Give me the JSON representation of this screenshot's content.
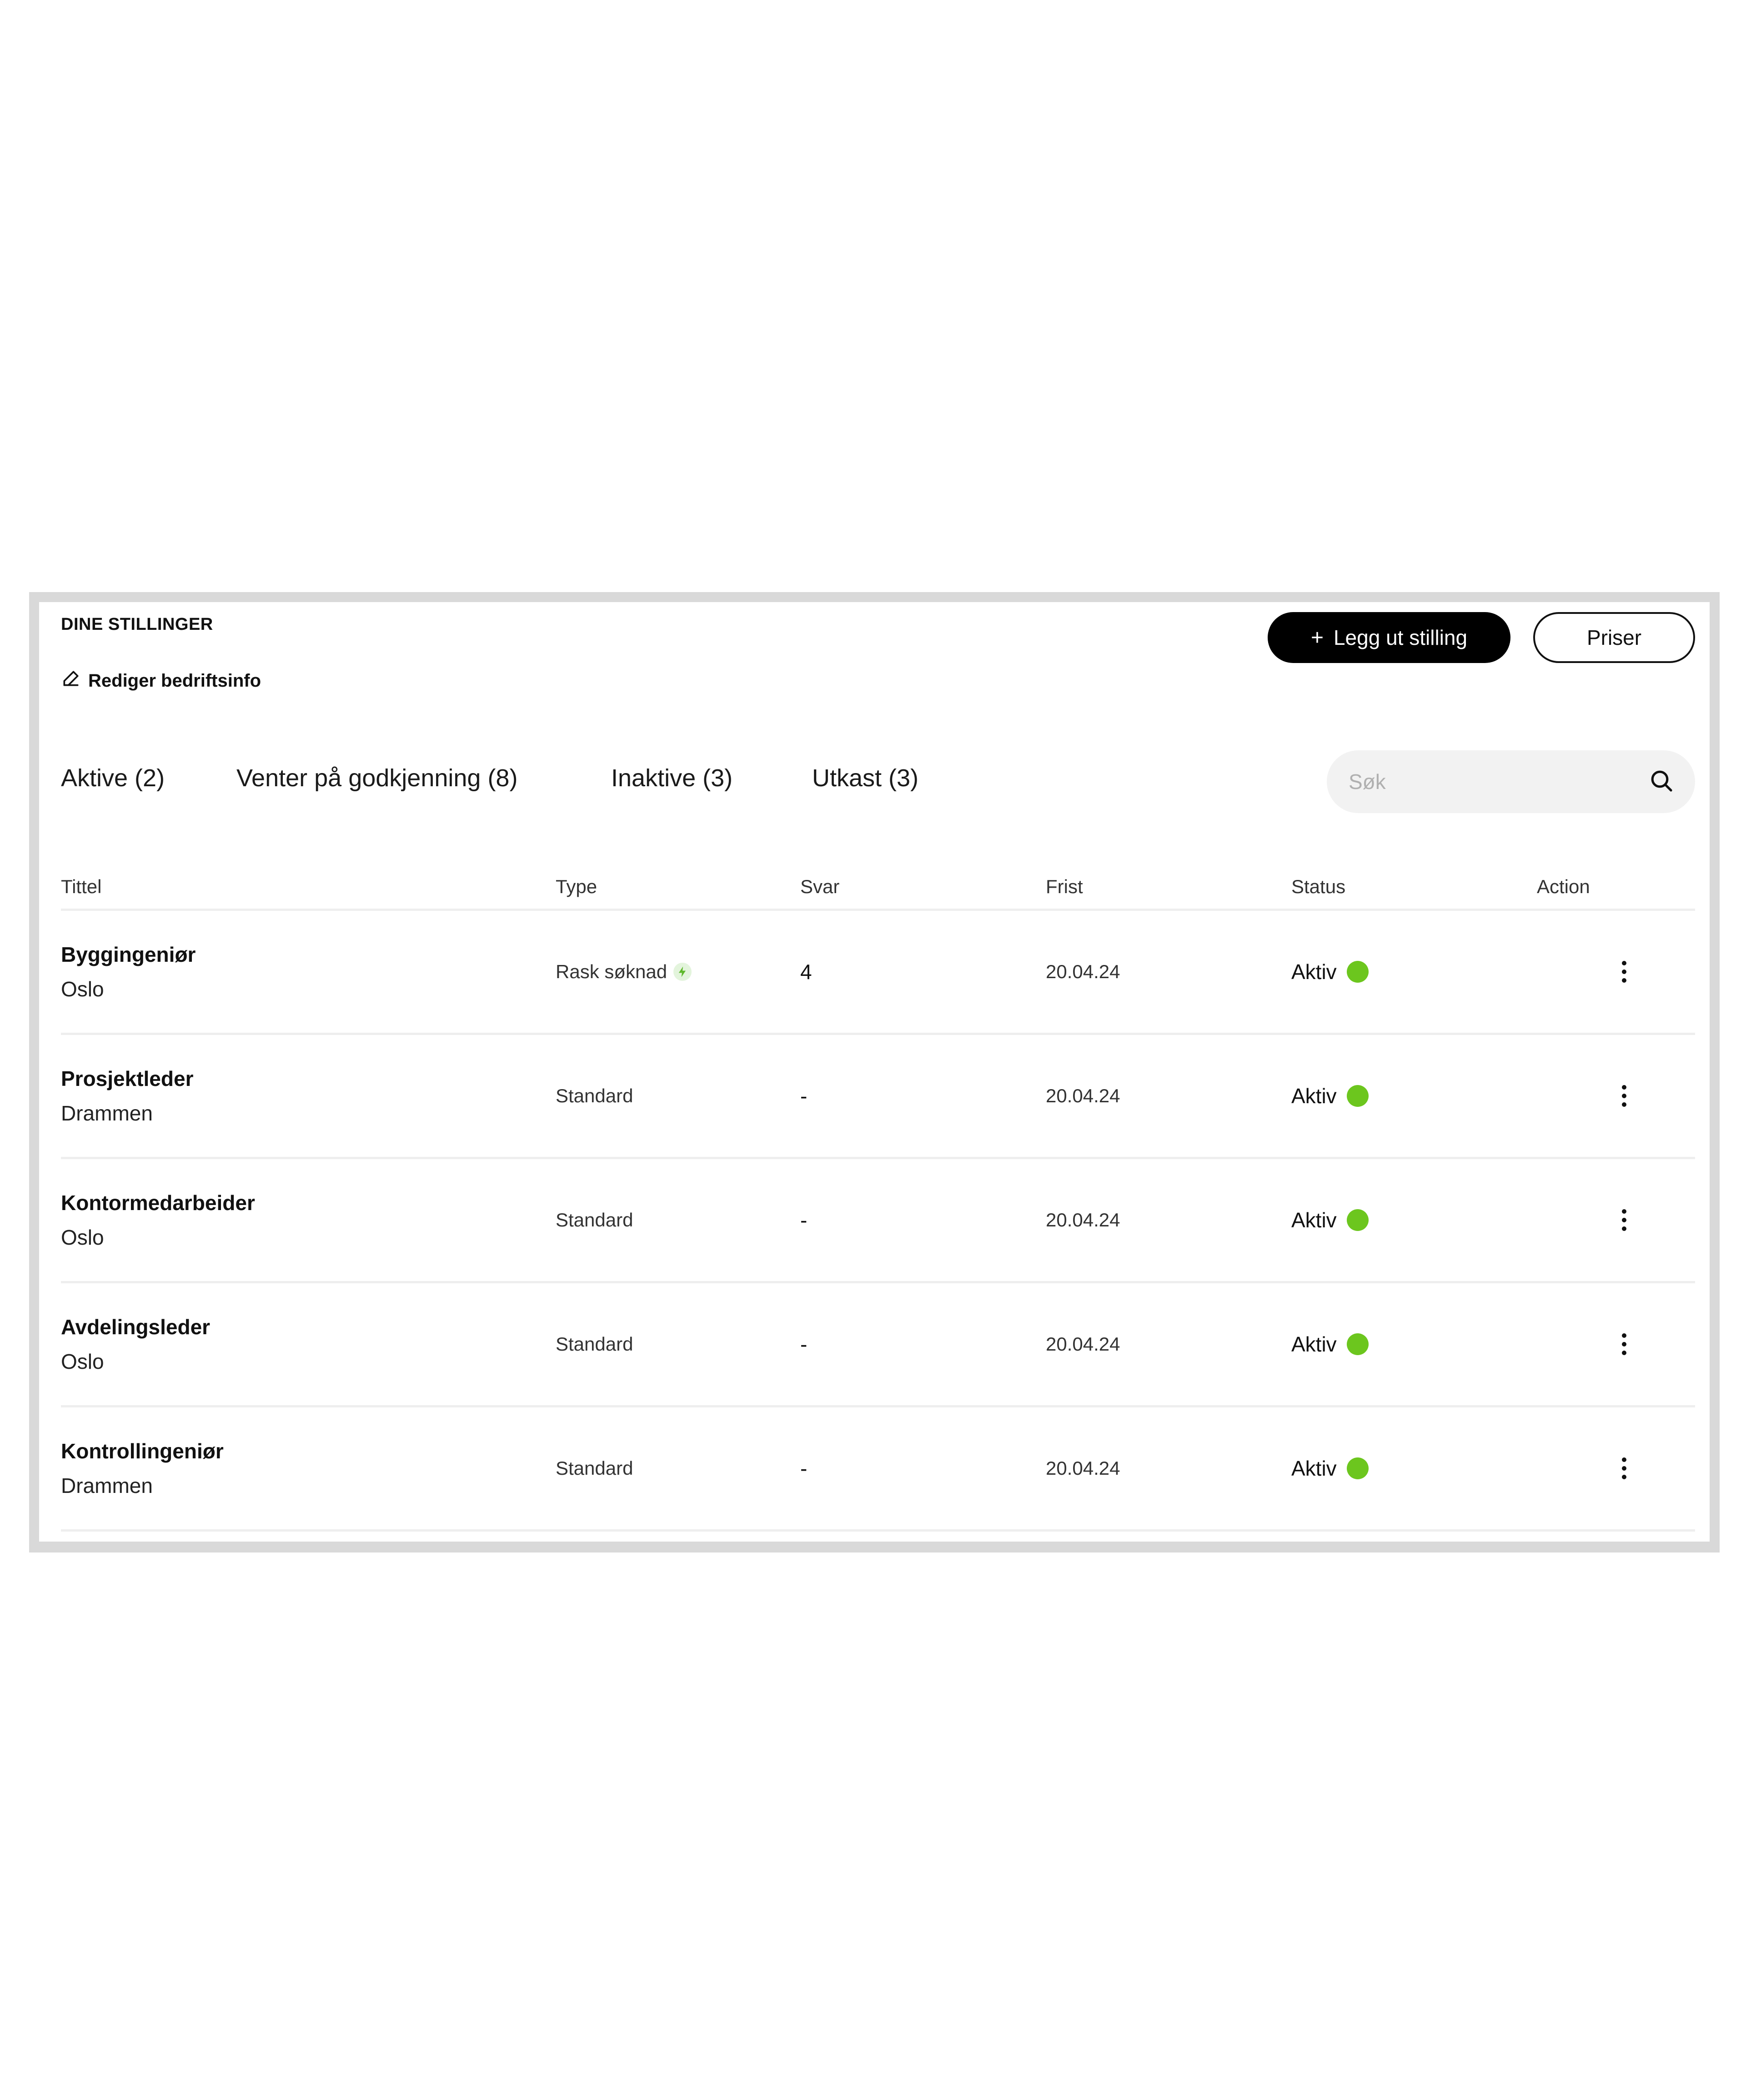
{
  "header": {
    "title": "DINE STILLINGER",
    "edit_label": "Rediger bedriftsinfo",
    "primary_button": {
      "icon": "+",
      "label": "Legg ut stilling"
    },
    "secondary_button": {
      "label": "Priser"
    }
  },
  "tabs": [
    {
      "label": "Aktive (2)"
    },
    {
      "label": "Venter på godkjenning (8)"
    },
    {
      "label": "Inaktive (3)"
    },
    {
      "label": "Utkast (3)"
    }
  ],
  "search": {
    "placeholder": "Søk",
    "value": ""
  },
  "table": {
    "columns": [
      "Tittel",
      "Type",
      "Svar",
      "Frist",
      "Status",
      "Action"
    ],
    "rows": [
      {
        "title": "Byggingeniør",
        "location": "Oslo",
        "type": "Rask søknad",
        "fast_apply": true,
        "svar": "4",
        "frist": "20.04.24",
        "status": "Aktiv"
      },
      {
        "title": "Prosjektleder",
        "location": "Drammen",
        "type": "Standard",
        "fast_apply": false,
        "svar": "-",
        "frist": "20.04.24",
        "status": "Aktiv"
      },
      {
        "title": "Kontormedarbeider",
        "location": "Oslo",
        "type": "Standard",
        "fast_apply": false,
        "svar": "-",
        "frist": "20.04.24",
        "status": "Aktiv"
      },
      {
        "title": "Avdelingsleder",
        "location": "Oslo",
        "type": "Standard",
        "fast_apply": false,
        "svar": "-",
        "frist": "20.04.24",
        "status": "Aktiv"
      },
      {
        "title": "Kontrollingeniør",
        "location": "Drammen",
        "type": "Standard",
        "fast_apply": false,
        "svar": "-",
        "frist": "20.04.24",
        "status": "Aktiv"
      }
    ]
  },
  "colors": {
    "status_active": "#6cc61e",
    "primary_button_bg": "#000000",
    "frame_border": "#d9d9d9",
    "search_bg": "#f2f2f2"
  },
  "icons": {
    "edit": "pencil-icon",
    "search": "search-icon",
    "fast_apply": "lightning-icon",
    "row_action": "more-vertical-icon"
  }
}
